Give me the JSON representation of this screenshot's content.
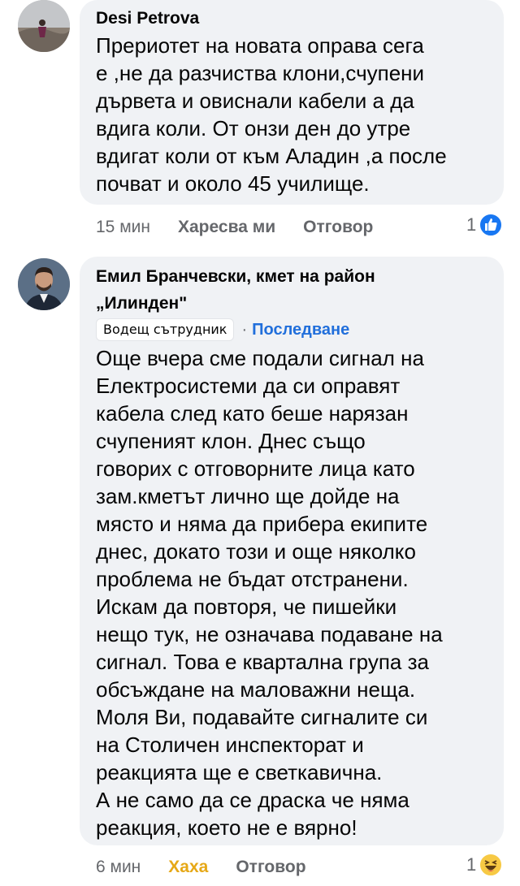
{
  "comments": [
    {
      "author": "Desi Petrova",
      "text": "Прериотет на новата оправа сега\nе ,не да разчиства клони,счупени\nдървета и овиснали кабели а да\nвдига коли. От онзи ден до утре\nвдигат коли от към Аладин ,а после\nпочват и около 45 училище.",
      "time": "15 мин",
      "like_label": "Харесва ми",
      "reply_label": "Отговор",
      "reaction_count": "1",
      "reaction_icon": "like-icon"
    },
    {
      "author_line1": "Емил Бранчевски, кмет на район",
      "author_line2": "„Илинден\"",
      "badge": "Водещ сътрудник",
      "follow_label": "Последване",
      "text": "Още вчера сме подали сигнал на\nЕлектросистеми да си оправят\nкабела след като беше нарязан\nсчупеният клон. Днес също\nговорих с отговорните лица като\nзам.кметът лично ще дойде на\nмясто и няма да прибера екипите\nднес, докато този и още няколко\nпроблема не бъдат отстранени.\nИскам да повторя, че пишейки\nнещо тук, не означава подаване на\nсигнал. Това е квартална група за\nобсъждане на маловажни неща.\nМоля Ви, подавайте сигналите си\nна Столичен инспекторат и\nреакцията ще е светкавична.\nА не само да се драска че няма\nреакция, което не е вярно!",
      "time": "6 мин",
      "reaction_label": "Хаха",
      "reply_label": "Отговор",
      "reaction_count": "1",
      "reaction_icon": "haha-icon"
    }
  ],
  "colors": {
    "bubble": "#f0f2f5",
    "meta": "#65676b",
    "link_blue": "#216fdb",
    "haha_yellow": "#e6a817",
    "like_blue": "#1877f2"
  }
}
